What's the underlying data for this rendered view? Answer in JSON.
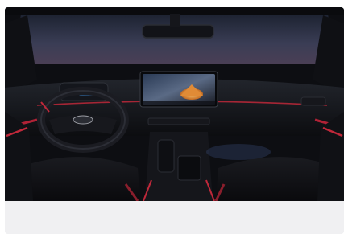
{
  "image": {
    "subject": "car-interior-dashboard",
    "alt": ""
  },
  "caption": {
    "text": ""
  },
  "colors": {
    "card_background": "#f0f0f2",
    "accent_red": "#c0283a",
    "screen_glow": "#d98a3a",
    "cabin_dark": "#111318"
  }
}
